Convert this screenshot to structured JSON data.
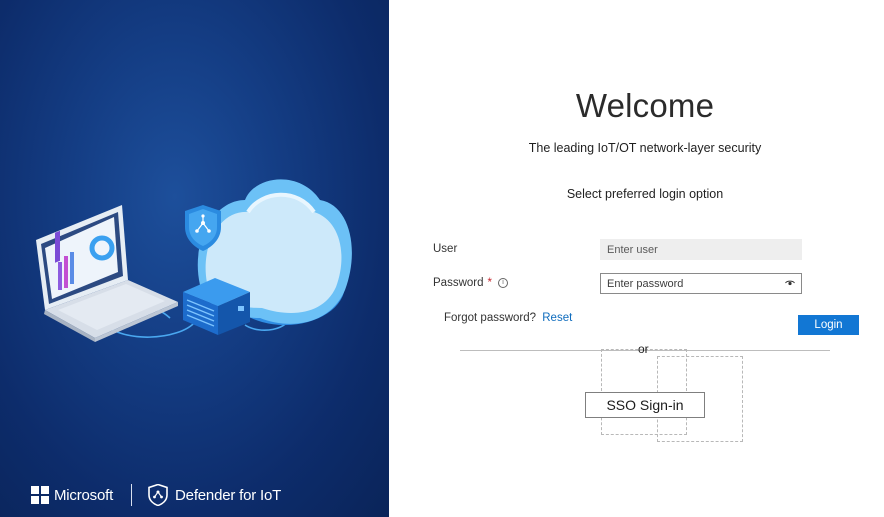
{
  "brand": {
    "company": "Microsoft",
    "product": "Defender for IoT"
  },
  "login": {
    "title": "Welcome",
    "tagline": "The leading IoT/OT network-layer security",
    "select_option": "Select preferred login option",
    "user_label": "User",
    "user_placeholder": "Enter user",
    "password_label": "Password",
    "required_marker": "*",
    "info_glyph": "i",
    "password_placeholder": "Enter password",
    "forgot_text": "Forgot password?",
    "reset_link": "Reset",
    "login_button": "Login",
    "or_separator": "or",
    "sso_button": "SSO Sign-in"
  },
  "colors": {
    "hero_background": "#0d2c6b",
    "accent": "#1277d4",
    "link": "#0f6cbd",
    "required": "#c4262e"
  },
  "icons": {
    "brand_logo": "microsoft-logo-icon",
    "product_logo": "defender-shield-icon",
    "password_toggle": "eye-icon",
    "password_info": "info-icon"
  }
}
